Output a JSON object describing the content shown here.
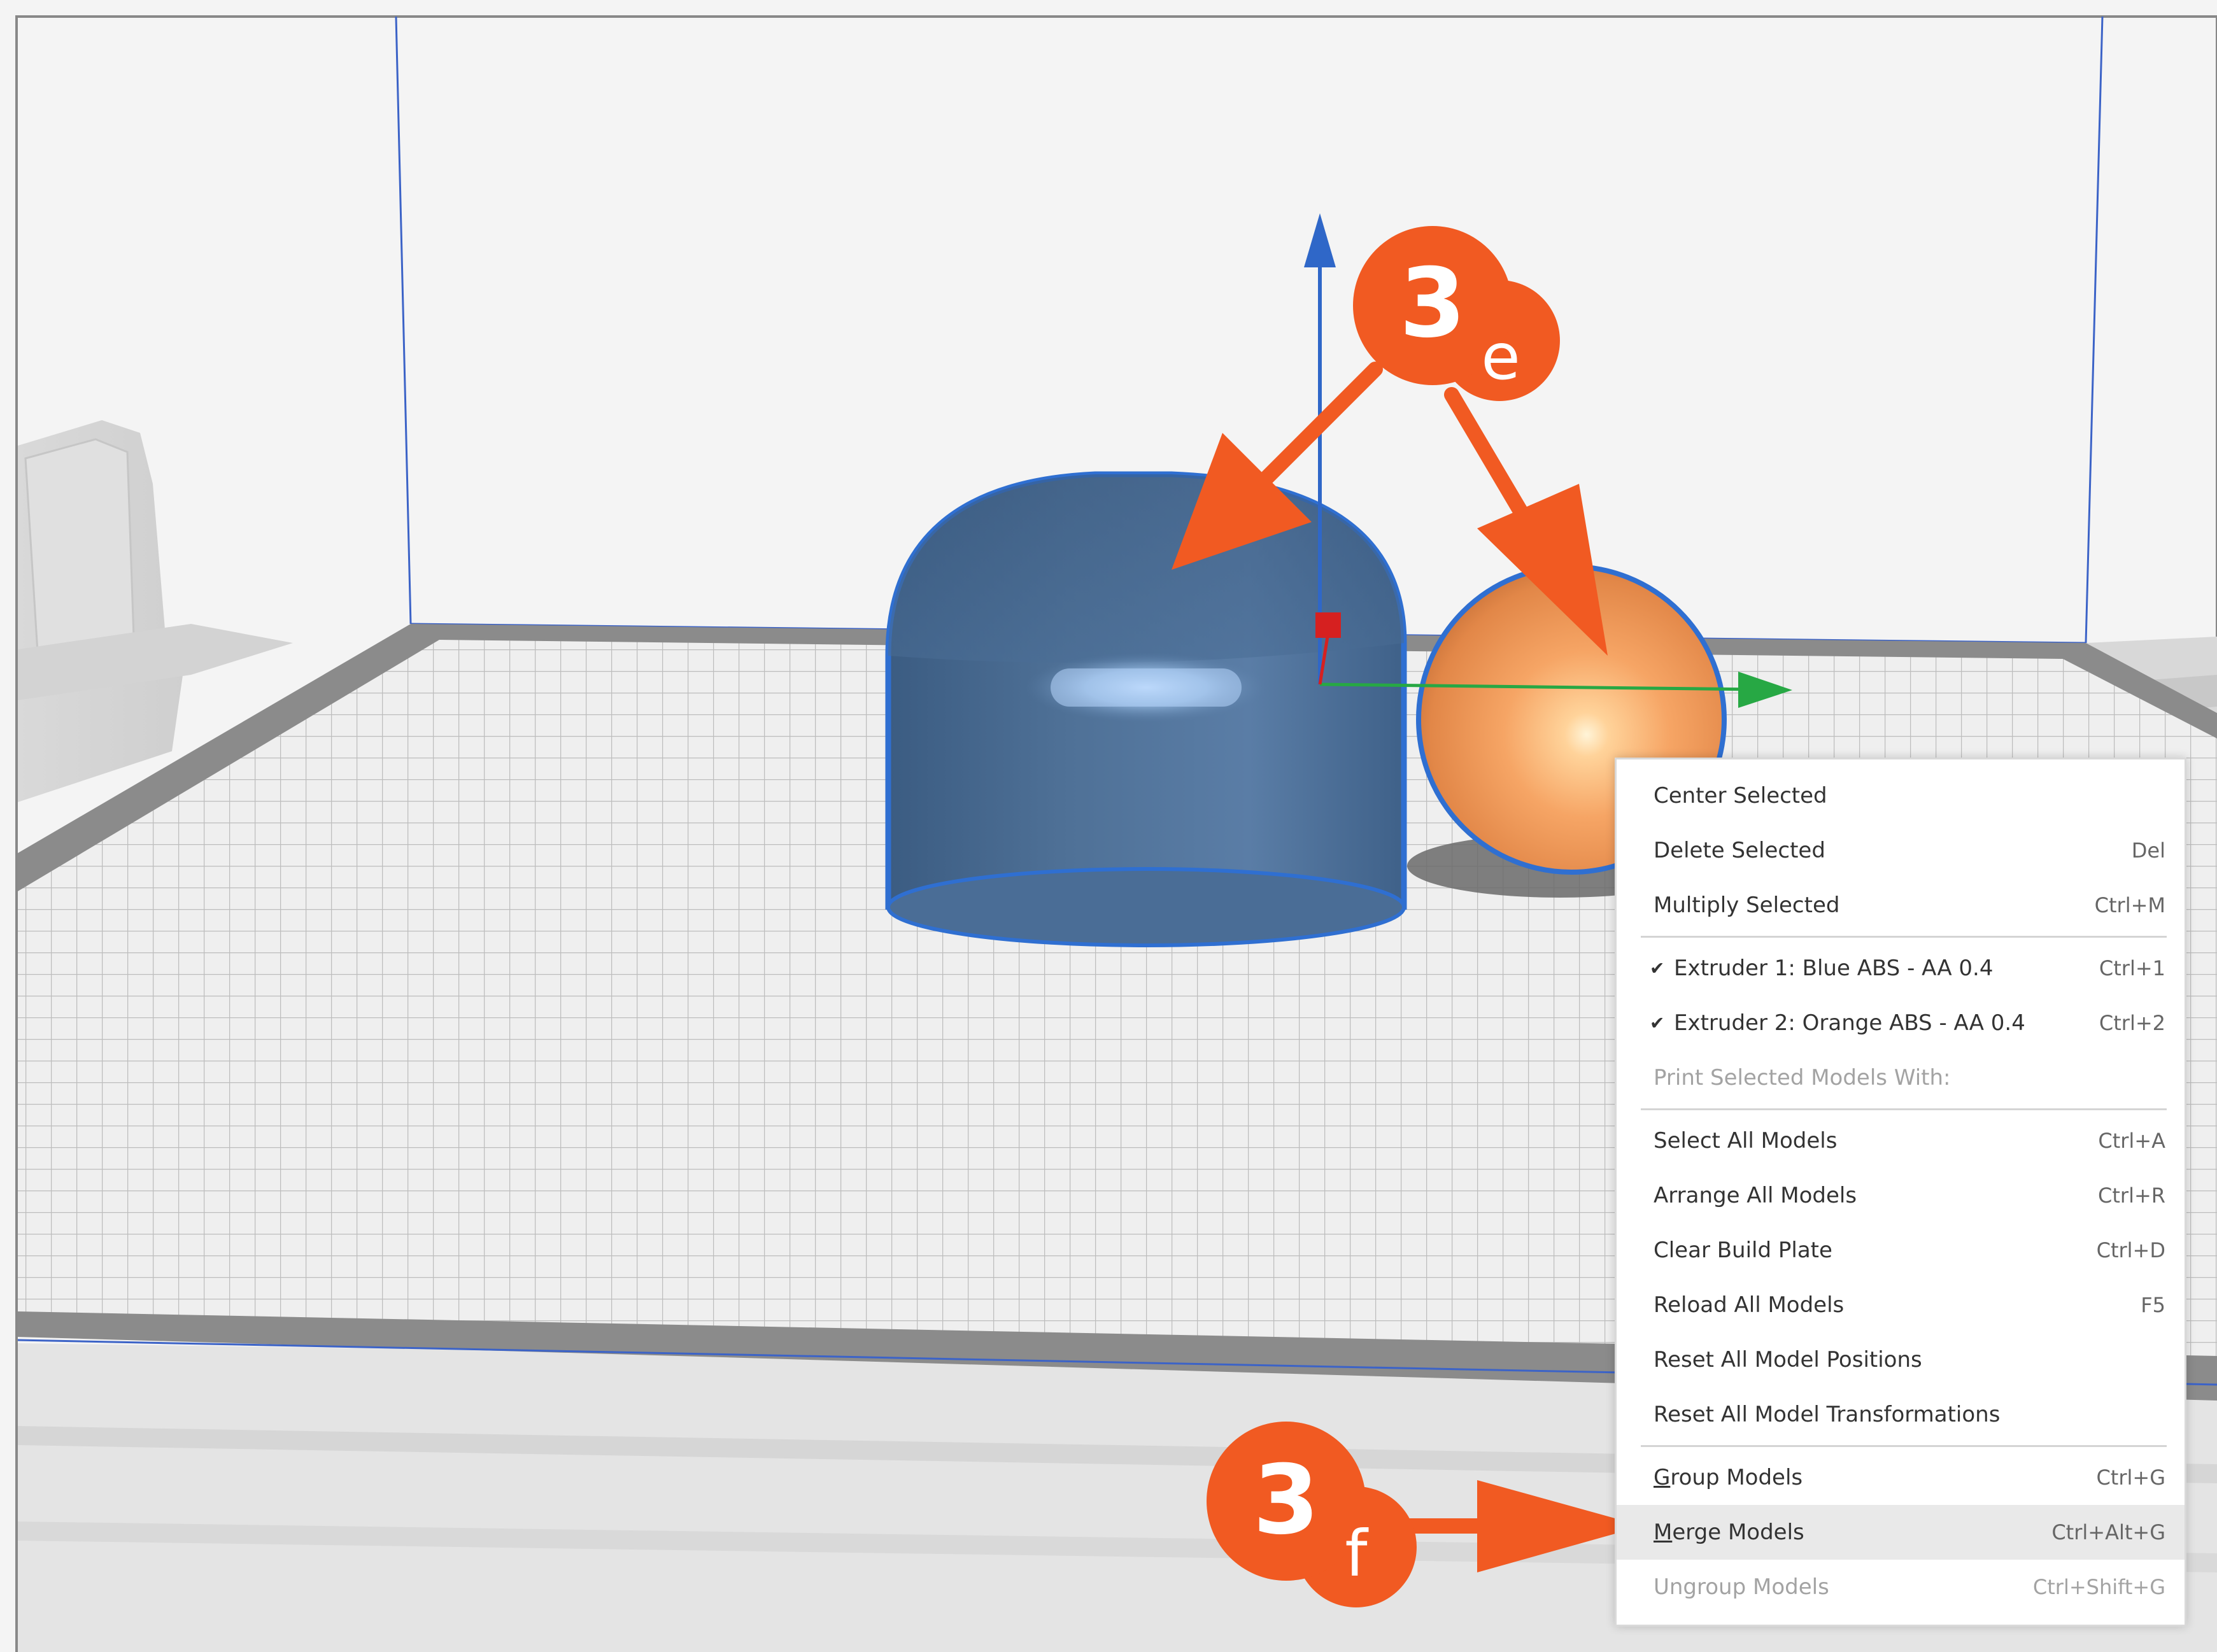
{
  "annotations": {
    "callout_e": {
      "number": "3",
      "letter": "e"
    },
    "callout_f": {
      "number": "3",
      "letter": "f"
    }
  },
  "colors": {
    "annotation_orange": "#f15a22",
    "blue_model": "#4a6f9a",
    "orange_model": "#f4a060",
    "selection_outline": "#2f6fd1",
    "axis_z": "#2f67c8",
    "axis_x": "#27a844",
    "axis_y": "#d62020"
  },
  "context_menu": {
    "center_selected": {
      "label": "Center Selected",
      "shortcut": ""
    },
    "delete_selected": {
      "label": "Delete Selected",
      "shortcut": "Del"
    },
    "multiply_selected": {
      "label": "Multiply Selected",
      "shortcut": "Ctrl+M"
    },
    "extruder_1": {
      "label": "Extruder 1: Blue ABS - AA 0.4",
      "shortcut": "Ctrl+1",
      "checked": true
    },
    "extruder_2": {
      "label": "Extruder 2: Orange ABS - AA 0.4",
      "shortcut": "Ctrl+2",
      "checked": true
    },
    "print_with": {
      "label": "Print Selected Models With:",
      "shortcut": ""
    },
    "select_all": {
      "label": "Select All Models",
      "shortcut": "Ctrl+A"
    },
    "arrange_all": {
      "label": "Arrange All Models",
      "shortcut": "Ctrl+R"
    },
    "clear_plate": {
      "label": "Clear Build Plate",
      "shortcut": "Ctrl+D"
    },
    "reload_all": {
      "label": "Reload All Models",
      "shortcut": "F5"
    },
    "reset_positions": {
      "label": "Reset All Model Positions",
      "shortcut": ""
    },
    "reset_transformations": {
      "label": "Reset All Model Transformations",
      "shortcut": ""
    },
    "group_models": {
      "label": "Group Models",
      "shortcut": "Ctrl+G"
    },
    "merge_models": {
      "label": "Merge Models",
      "shortcut": "Ctrl+Alt+G"
    },
    "ungroup_models": {
      "label": "Ungroup Models",
      "shortcut": "Ctrl+Shift+G"
    },
    "check_mark": "✔"
  }
}
